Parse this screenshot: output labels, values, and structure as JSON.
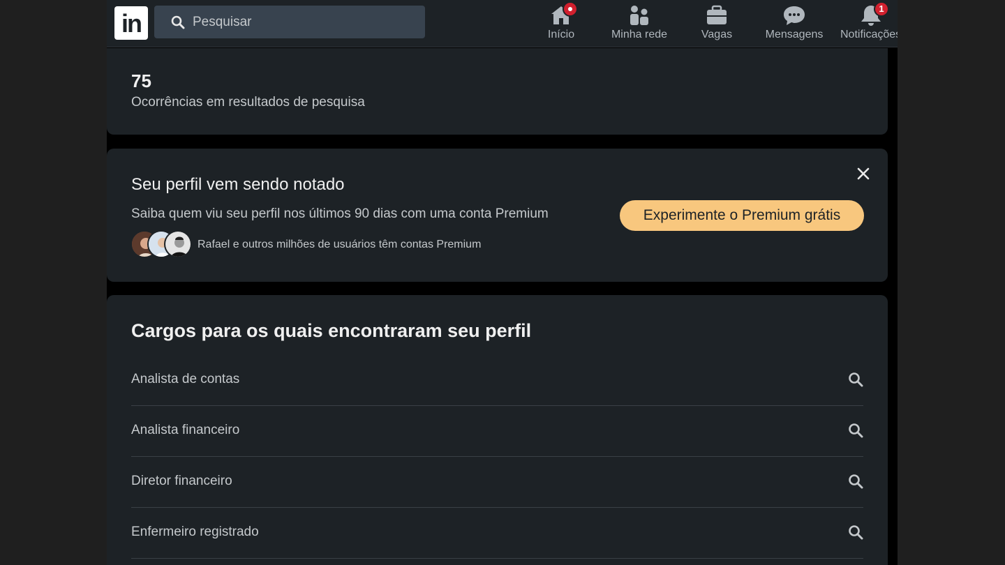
{
  "nav": {
    "logo_text": "in",
    "search_placeholder": "Pesquisar",
    "items": [
      {
        "label": "Início",
        "icon": "home-icon",
        "badge": ""
      },
      {
        "label": "Minha rede",
        "icon": "network-icon",
        "badge": ""
      },
      {
        "label": "Vagas",
        "icon": "briefcase-icon",
        "badge": ""
      },
      {
        "label": "Mensagens",
        "icon": "messaging-icon",
        "badge": ""
      },
      {
        "label": "Notificações",
        "icon": "bell-icon",
        "badge": "1"
      }
    ]
  },
  "stats": {
    "count": "75",
    "label": "Ocorrências em resultados de pesquisa"
  },
  "promo": {
    "title": "Seu perfil vem sendo notado",
    "subtitle": "Saiba quem viu seu perfil nos últimos 90 dias com uma conta Premium",
    "users_text": "Rafael e outros milhões de usuários têm contas Premium",
    "button_label": "Experimente o Premium grátis"
  },
  "jobs": {
    "title": "Cargos para os quais encontraram seu perfil",
    "items": [
      {
        "label": "Analista de contas"
      },
      {
        "label": "Analista financeiro"
      },
      {
        "label": "Diretor financeiro"
      },
      {
        "label": "Enfermeiro registrado"
      }
    ]
  },
  "colors": {
    "background": "#000000",
    "card": "#1d2226",
    "premium_accent": "#f8c77e",
    "badge": "#d1202e"
  }
}
